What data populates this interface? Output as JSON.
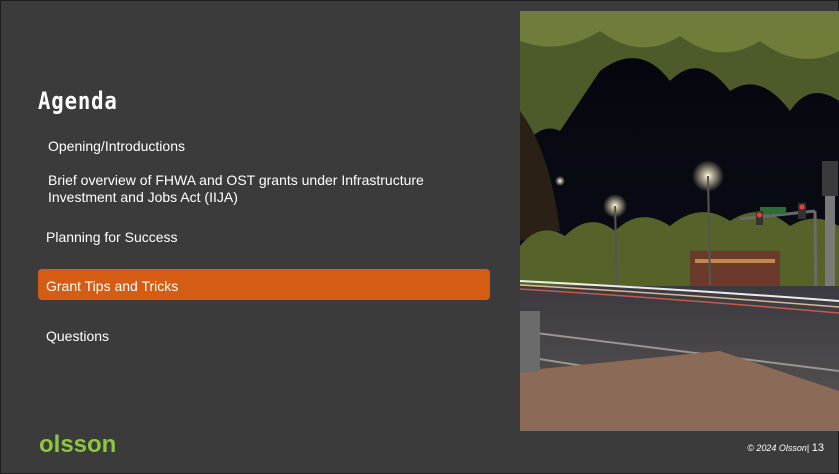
{
  "slide": {
    "title": "Agenda",
    "items": [
      {
        "label": "Opening/Introductions"
      },
      {
        "label": "Brief overview of FHWA and OST grants under Infrastructure"
      },
      {
        "label": "Investment and Jobs Act (IIJA)"
      },
      {
        "label": "Planning for Success"
      },
      {
        "label": "Grant Tips and Tricks"
      },
      {
        "label": "Questions"
      }
    ],
    "highlight_color": "#d45d13",
    "logo": "olsson",
    "logo_color": "#8dc63f",
    "copyright": "© 2024 Olsson",
    "page_number": "13"
  }
}
